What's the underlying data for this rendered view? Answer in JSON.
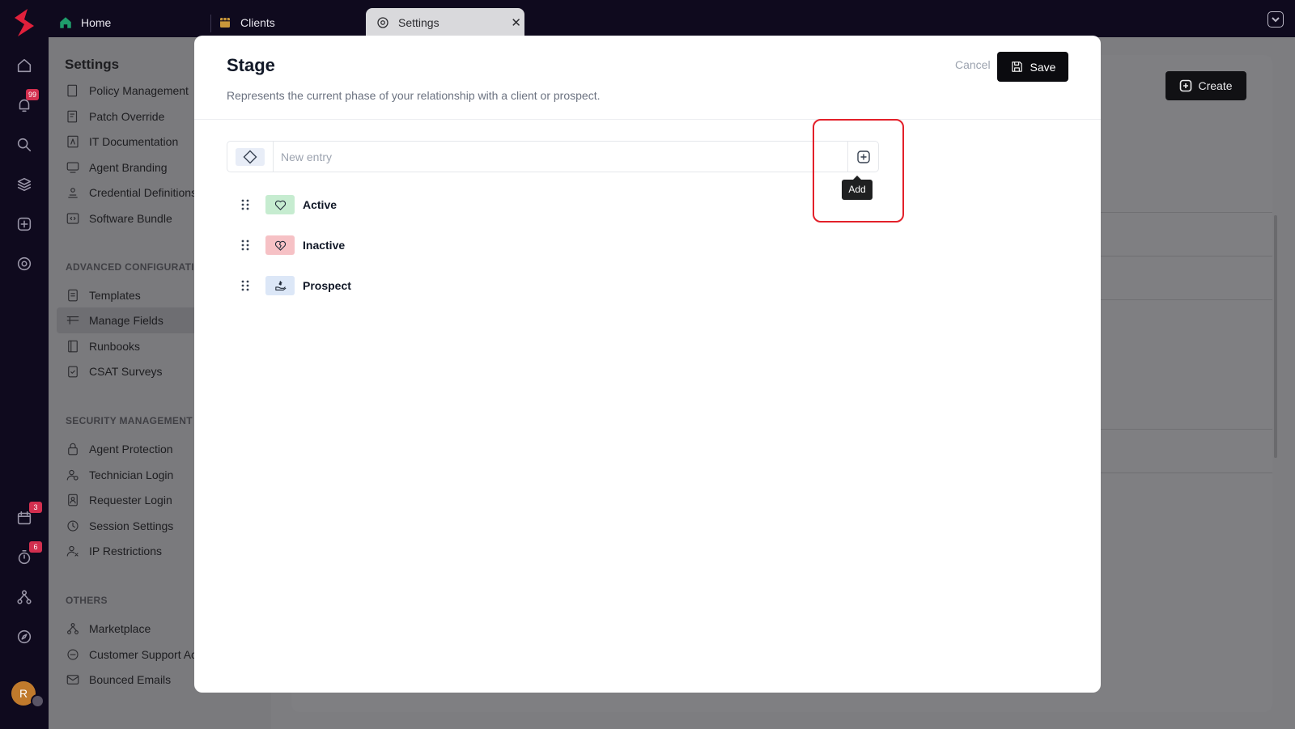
{
  "tabs": [
    {
      "label": "Home",
      "icon": "home-icon"
    },
    {
      "label": "Clients",
      "icon": "store-icon"
    },
    {
      "label": "Settings",
      "icon": "gear-icon",
      "active": true
    }
  ],
  "rail": {
    "badges": {
      "notifications": "99",
      "calendar": "3",
      "timer": "6"
    },
    "avatar_initial": "R"
  },
  "settings": {
    "title": "Settings",
    "items_top": [
      "Policy Management",
      "Patch Override",
      "IT Documentation",
      "Agent Branding",
      "Credential Definitions",
      "Software Bundle"
    ],
    "section_advanced": "ADVANCED CONFIGURATION",
    "items_advanced": [
      "Templates",
      "Manage Fields",
      "Runbooks",
      "CSAT Surveys"
    ],
    "section_security": "SECURITY MANAGEMENT",
    "items_security": [
      "Agent Protection",
      "Technician Login",
      "Requester Login",
      "Session Settings",
      "IP Restrictions"
    ],
    "section_others": "OTHERS",
    "items_others": [
      "Marketplace",
      "Customer Support Access",
      "Bounced Emails"
    ]
  },
  "background": {
    "create_label": "Create"
  },
  "modal": {
    "title": "Stage",
    "description": "Represents the current phase of your relationship with a client or prospect.",
    "cancel_label": "Cancel",
    "save_label": "Save",
    "entry_placeholder": "New entry",
    "entry_value": "",
    "add_tooltip": "Add",
    "items": [
      {
        "label": "Active",
        "icon": "heart-icon",
        "color": "#c6ecd0"
      },
      {
        "label": "Inactive",
        "icon": "broken-heart-icon",
        "color": "#f6c1c5"
      },
      {
        "label": "Prospect",
        "icon": "hand-coin-icon",
        "color": "#dce7f7"
      }
    ]
  },
  "colors": {
    "accent_dark": "#0b0b0f",
    "highlight": "#e3202a",
    "brand": "#e1203b"
  }
}
